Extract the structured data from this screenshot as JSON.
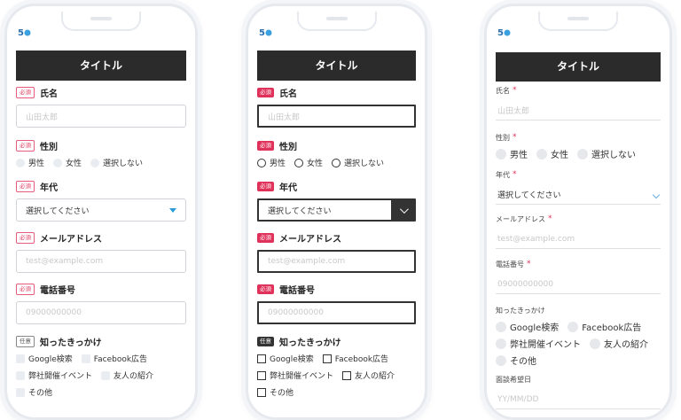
{
  "screens": [
    {
      "title": "タイトル",
      "fields": {
        "name": {
          "badge": "必須",
          "label": "氏名",
          "placeholder": "山田太郎"
        },
        "gender": {
          "badge": "必須",
          "label": "性別",
          "options": [
            "男性",
            "女性",
            "選択しない"
          ]
        },
        "age": {
          "badge": "必須",
          "label": "年代",
          "value": "選択してください"
        },
        "email": {
          "badge": "必須",
          "label": "メールアドレス",
          "placeholder": "test@example.com"
        },
        "phone": {
          "badge": "必須",
          "label": "電話番号",
          "placeholder": "09000000000"
        },
        "source": {
          "badge": "任意",
          "label": "知ったきっかけ",
          "options": [
            "Google検索",
            "Facebook広告",
            "弊社開催イベント",
            "友人の紹介",
            "その他"
          ]
        }
      }
    },
    {
      "title": "タイトル",
      "fields": {
        "name": {
          "badge": "必須",
          "label": "氏名",
          "placeholder": "山田太郎"
        },
        "gender": {
          "badge": "必須",
          "label": "性別",
          "options": [
            "男性",
            "女性",
            "選択しない"
          ]
        },
        "age": {
          "badge": "必須",
          "label": "年代",
          "value": "選択してください"
        },
        "email": {
          "badge": "必須",
          "label": "メールアドレス",
          "placeholder": "test@example.com"
        },
        "phone": {
          "badge": "必須",
          "label": "電話番号",
          "placeholder": "09000000000"
        },
        "source": {
          "badge": "任意",
          "label": "知ったきっかけ",
          "options": [
            "Google検索",
            "Facebook広告",
            "弊社開催イベント",
            "友人の紹介",
            "その他"
          ]
        }
      }
    },
    {
      "title": "タイトル",
      "required_mark": "*",
      "fields": {
        "name": {
          "label": "氏名",
          "placeholder": "山田太郎"
        },
        "gender": {
          "label": "性別",
          "options": [
            "男性",
            "女性",
            "選択しない"
          ]
        },
        "age": {
          "label": "年代",
          "value": "選択してください"
        },
        "email": {
          "label": "メールアドレス",
          "placeholder": "test@example.com"
        },
        "phone": {
          "label": "電話番号",
          "placeholder": "09000000000"
        },
        "source": {
          "label": "知ったきっかけ",
          "options": [
            "Google検索",
            "Facebook広告",
            "弊社開催イベント",
            "友人の紹介",
            "その他"
          ]
        },
        "date": {
          "label": "面談希望日",
          "placeholder": "YY/MM/DD"
        }
      }
    }
  ],
  "colors": {
    "title_bar": "#2b2b2b",
    "required": "#e0315a",
    "accent_blue": "#2a9ad8"
  }
}
